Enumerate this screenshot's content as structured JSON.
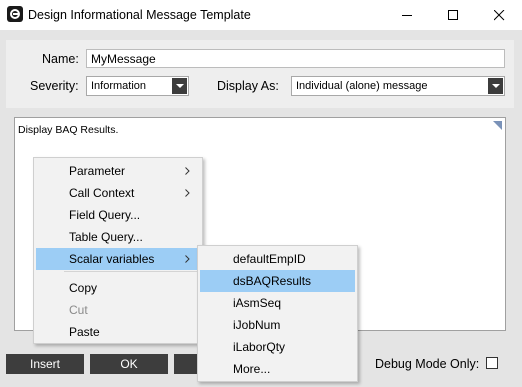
{
  "window": {
    "title": "Design Informational Message Template"
  },
  "form": {
    "name_label": "Name:",
    "name_value": "MyMessage",
    "severity_label": "Severity:",
    "severity_value": "Information",
    "display_label": "Display As:",
    "display_value": "Individual (alone) message"
  },
  "editor": {
    "text": "Display BAQ Results."
  },
  "buttons": {
    "insert": "Insert",
    "ok": "OK"
  },
  "debug_label": "Debug Mode Only:",
  "context_menu": {
    "items": [
      {
        "label": "Parameter",
        "submenu": true
      },
      {
        "label": "Call Context",
        "submenu": true
      },
      {
        "label": "Field Query..."
      },
      {
        "label": "Table Query..."
      },
      {
        "label": "Scalar variables",
        "submenu": true,
        "active": true
      },
      {
        "label": "Copy"
      },
      {
        "label": "Cut",
        "disabled": true
      },
      {
        "label": "Paste"
      }
    ]
  },
  "submenu": {
    "items": [
      {
        "label": "defaultEmpID"
      },
      {
        "label": "dsBAQResults",
        "active": true
      },
      {
        "label": "iAsmSeq"
      },
      {
        "label": "iJobNum"
      },
      {
        "label": "iLaborQty"
      },
      {
        "label": "More..."
      }
    ]
  },
  "colors": {
    "highlight": "#9ccdf5",
    "button_bg": "#3d3d3d"
  }
}
